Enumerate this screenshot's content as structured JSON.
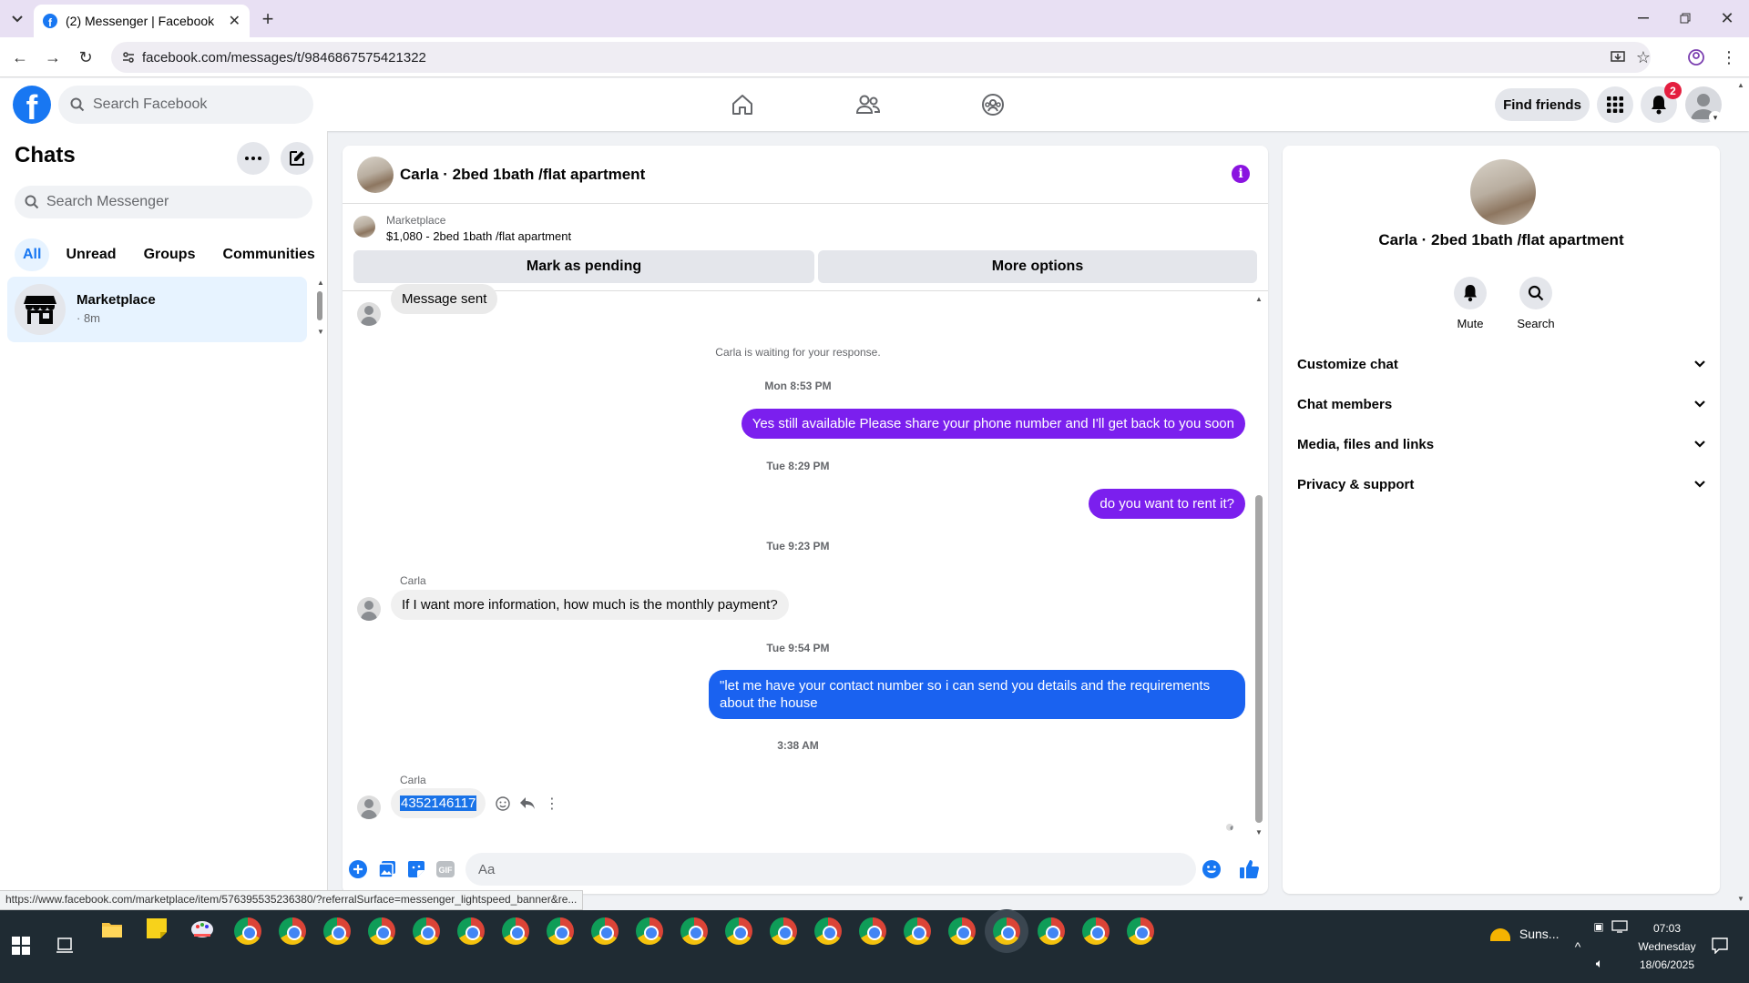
{
  "browser": {
    "tab_title": "(2) Messenger | Facebook",
    "url": "facebook.com/messages/t/9846867575421322",
    "status_url": "https://www.facebook.com/marketplace/item/576395535236380/?referralSurface=messenger_lightspeed_banner&re..."
  },
  "fb_header": {
    "search_placeholder": "Search Facebook",
    "find_friends_label": "Find friends",
    "notification_count": "2"
  },
  "chats_panel": {
    "title": "Chats",
    "search_placeholder": "Search Messenger",
    "filters": [
      "All",
      "Unread",
      "Groups",
      "Communities"
    ],
    "active_filter": "All",
    "items": [
      {
        "name": "Marketplace",
        "time": "· 8m"
      }
    ]
  },
  "conversation": {
    "title": "Carla · 2bed 1bath /flat apartment",
    "marketplace_label": "Marketplace",
    "listing": "$1,080 - 2bed 1bath /flat apartment",
    "mark_pending_label": "Mark as pending",
    "more_options_label": "More options",
    "messages": {
      "m0": {
        "text": "Message sent"
      },
      "waiting": "Carla is waiting for your response.",
      "t1": "Mon 8:53 PM",
      "m1": {
        "text": "Yes still available Please share your phone number and I'll get back to you soon"
      },
      "t2": "Tue 8:29 PM",
      "m2": {
        "text": "do you want to rent it?"
      },
      "t3": "Tue 9:23 PM",
      "m3": {
        "sender": "Carla",
        "text": "If I want more information, how much is the monthly payment?"
      },
      "t4": "Tue 9:54 PM",
      "m4": {
        "text": "\"let me have your contact number so i can send you details and the requirements about the house"
      },
      "t5": "3:38 AM",
      "m5": {
        "sender": "Carla",
        "text": "4352146117"
      }
    },
    "composer_placeholder": "Aa"
  },
  "details_panel": {
    "name": "Carla · 2bed 1bath /flat apartment",
    "mute_label": "Mute",
    "search_label": "Search",
    "sections": [
      "Customize chat",
      "Chat members",
      "Media, files and links",
      "Privacy & support"
    ]
  },
  "taskbar": {
    "weather": "Suns...",
    "time": "07:03",
    "day": "Wednesday",
    "date": "18/06/2025"
  },
  "colors": {
    "facebook_blue": "#1877f2",
    "messenger_purple": "#7b1fee",
    "notification_red": "#e41e3f"
  }
}
